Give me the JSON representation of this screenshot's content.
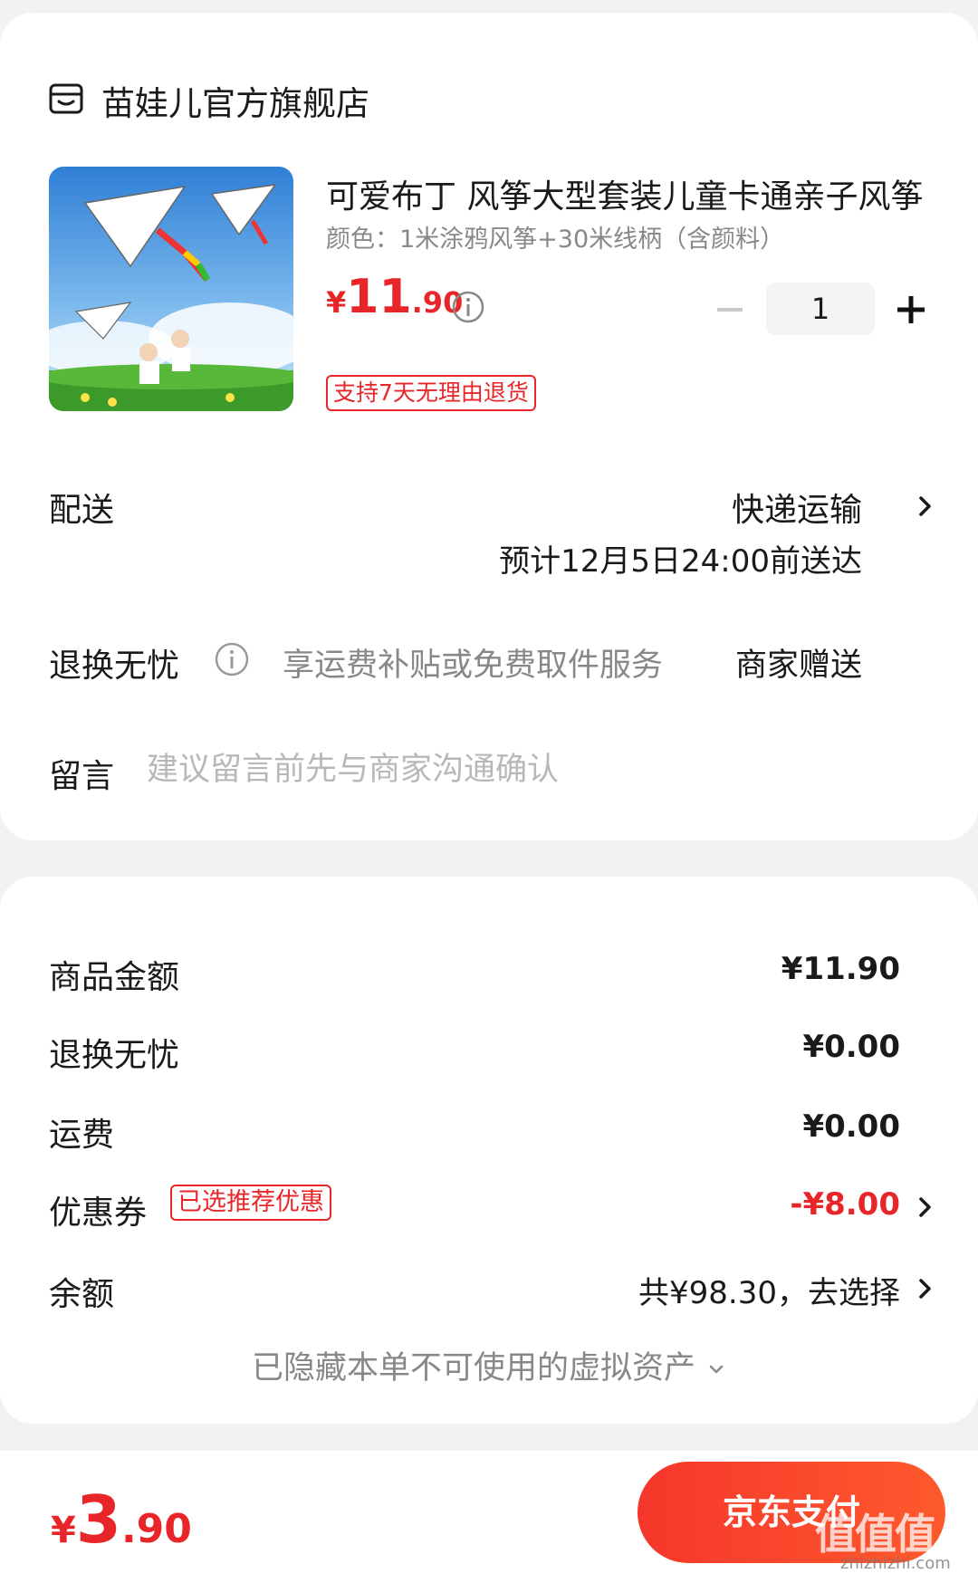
{
  "store": {
    "icon": "store-icon",
    "name": "苗娃儿官方旗舰店"
  },
  "product": {
    "image": "kite-product-photo",
    "title": "可爱布丁 风筝大型套装儿童卡通亲子风筝",
    "spec": "颜色：1米涂鸦风筝+30米线柄（含颜料）",
    "price_currency": "¥",
    "price_int": "11",
    "price_dec": ".90",
    "quantity": "1",
    "return_badge": "支持7天无理由退货"
  },
  "delivery": {
    "label": "配送",
    "method": "快递运输",
    "eta": "预计12月5日24:00前送达"
  },
  "worry_free": {
    "label": "退换无忧",
    "desc": "享运费补贴或免费取件服务",
    "gift": "商家赠送"
  },
  "message": {
    "label": "留言",
    "placeholder": "建议留言前先与商家沟通确认"
  },
  "summary": {
    "goods_label": "商品金额",
    "goods_value": "¥11.90",
    "worry_label": "退换无忧",
    "worry_value": "¥0.00",
    "freight_label": "运费",
    "freight_value": "¥0.00",
    "coupon_label": "优惠券",
    "coupon_tag": "已选推荐优惠",
    "coupon_value": "-¥8.00",
    "balance_label": "余额",
    "balance_value": "共¥98.30，去选择",
    "hidden_assets": "已隐藏本单不可使用的虚拟资产"
  },
  "footer": {
    "total_currency": "¥",
    "total_int": "3",
    "total_dec": ".90",
    "pay_label": "京东支付",
    "watermark": "值值值",
    "watermark_sub": "zhizhizhi.com"
  },
  "colors": {
    "accent": "#e8262a",
    "pay_gradient_start": "#f6362b",
    "pay_gradient_end": "#fe5a2d"
  }
}
